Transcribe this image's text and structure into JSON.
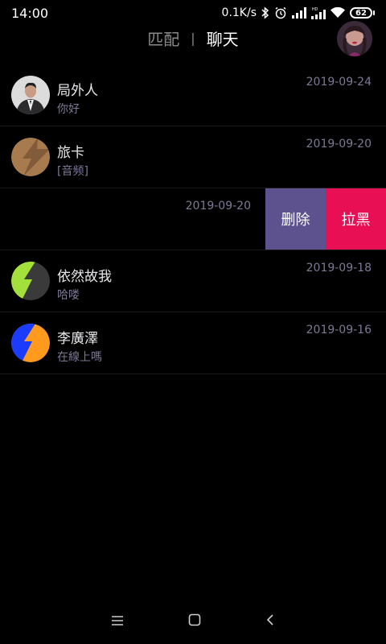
{
  "status_bar": {
    "time": "14:00",
    "net_speed": "0.1K/s",
    "battery_level": "62",
    "icons": [
      "bluetooth-icon",
      "alarm-icon",
      "signal-icon",
      "hd-signal-icon",
      "wifi-icon",
      "battery-icon"
    ]
  },
  "header": {
    "tab_match": "匹配",
    "separator": "|",
    "tab_chat": "聊天",
    "active_tab": "聊天"
  },
  "conversations": [
    {
      "name": "局外人",
      "last_message": "你好",
      "date": "2019-09-24",
      "avatar": "photo-avatar"
    },
    {
      "name": "旅卡",
      "last_message": "[音频]",
      "date": "2019-09-20",
      "avatar": "bolt-avatar",
      "avatar_color": "#a87b4f"
    },
    {
      "name": "",
      "last_message": "",
      "date": "2019-09-20",
      "swiped": true,
      "actions": [
        "删除",
        "拉黑"
      ]
    },
    {
      "name": "依然故我",
      "last_message": "哈喽",
      "date": "2019-09-18",
      "avatar": "bolt-avatar",
      "avatar_color": "#a4e03c"
    },
    {
      "name": "李廣澤",
      "last_message": "在線上嗎",
      "date": "2019-09-16",
      "avatar": "bolt-avatar",
      "avatar_color": "#ff9a1f"
    }
  ],
  "colors": {
    "delete_action": "#5d528e",
    "block_action": "#e90f55",
    "secondary_text": "#7d7896",
    "background": "#000000"
  },
  "nav_bar": {
    "icons": [
      "menu-icon",
      "home-icon",
      "back-icon"
    ]
  }
}
